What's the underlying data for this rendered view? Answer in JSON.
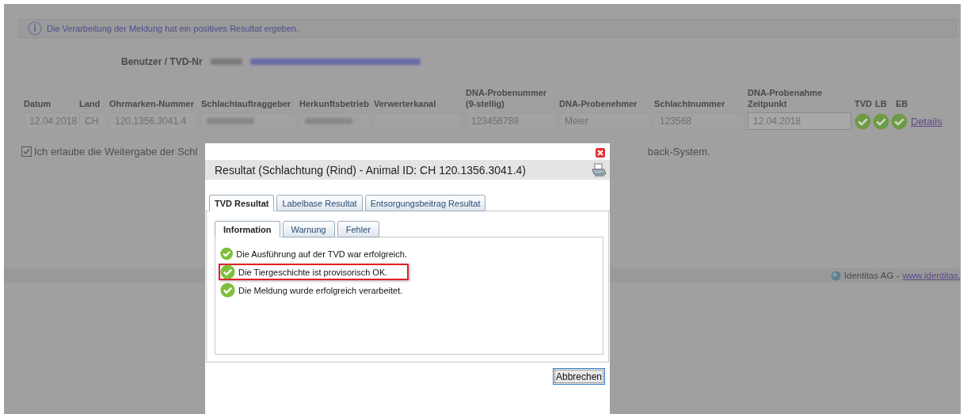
{
  "info_message": "Die Verarbeitung der Meldung hat ein positives Resultat ergeben.",
  "user": {
    "label": "Benutzer / TVD-Nr"
  },
  "table": {
    "columns": [
      "Datum",
      "Land",
      "Ohrmarken-Nummer",
      "Schlachtauftraggeber",
      "Herkunftsbetrieb",
      "Verwerterkanal",
      "DNA-Probenummer (9-stellig)",
      "DNA-Probenehmer",
      "Schlachtnummer",
      "DNA-Probenahme Zeitpunkt",
      "TVD",
      "LB",
      "EB"
    ],
    "rows": [
      {
        "cells": [
          {
            "kind": "text",
            "value": "12.04.2018"
          },
          {
            "kind": "text",
            "value": "CH"
          },
          {
            "kind": "text",
            "value": "120.1356.3041.4"
          },
          {
            "kind": "blurred"
          },
          {
            "kind": "blurred"
          },
          {
            "kind": "empty"
          },
          {
            "kind": "text",
            "value": "123456789"
          },
          {
            "kind": "text",
            "value": "Meier"
          },
          {
            "kind": "text",
            "value": "123568"
          },
          {
            "kind": "input",
            "value": "12.04.2018"
          }
        ],
        "status": [
          {
            "ok": true
          },
          {
            "ok": true
          },
          {
            "ok": true
          }
        ],
        "link": "Details"
      }
    ]
  },
  "consent": {
    "checked": true,
    "text_before": "Ich erlaube die Weitergabe der Schl",
    "text_after": "back-System."
  },
  "footer": {
    "company": "Identitas AG -",
    "link": "www.identitas."
  },
  "dialog": {
    "title": "Resultat (Schlachtung (Rind) - Animal ID: CH 120.1356.3041.4)",
    "tabs": [
      {
        "label": "TVD Resultat",
        "selected": true
      },
      {
        "label": "Labelbase Resultat",
        "selected": false
      },
      {
        "label": "Entsorgungsbeitrag Resultat",
        "selected": false
      }
    ],
    "subtabs": [
      {
        "label": "Information",
        "selected": true
      },
      {
        "label": "Warnung",
        "selected": false
      },
      {
        "label": "Fehler",
        "selected": false
      }
    ],
    "messages": [
      {
        "text": "Die Ausführung auf der TVD war erfolgreich.",
        "highlighted": false
      },
      {
        "text": "Die Tiergeschichte ist provisorisch OK.",
        "highlighted": true
      },
      {
        "text": "Die Meldung wurde erfolgreich verarbeitet.",
        "highlighted": false
      }
    ],
    "buttons": [
      "Abbrechen"
    ]
  }
}
